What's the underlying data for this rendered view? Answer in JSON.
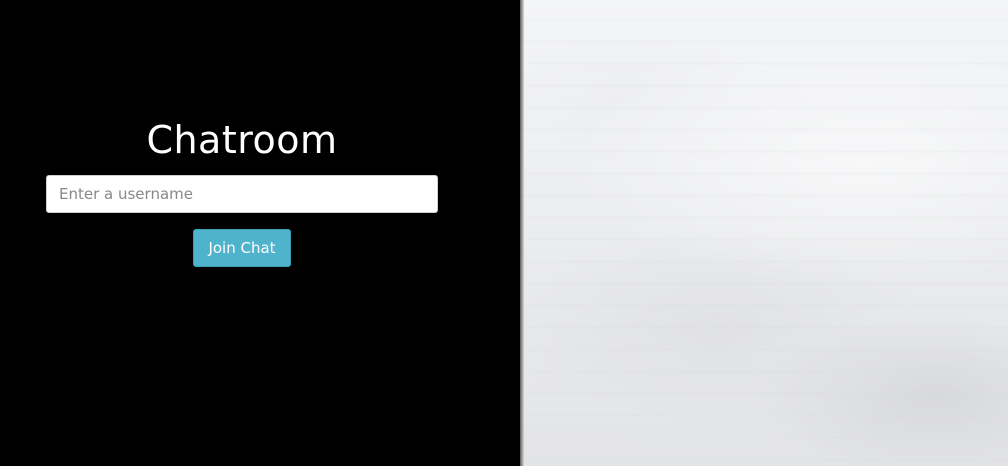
{
  "chatroom": {
    "title": "Chatroom",
    "username_placeholder": "Enter a username",
    "username_value": "",
    "join_label": "Join Chat"
  },
  "colors": {
    "left_background": "#000000",
    "button_background": "#4fb3cc",
    "title_text": "#ffffff"
  }
}
